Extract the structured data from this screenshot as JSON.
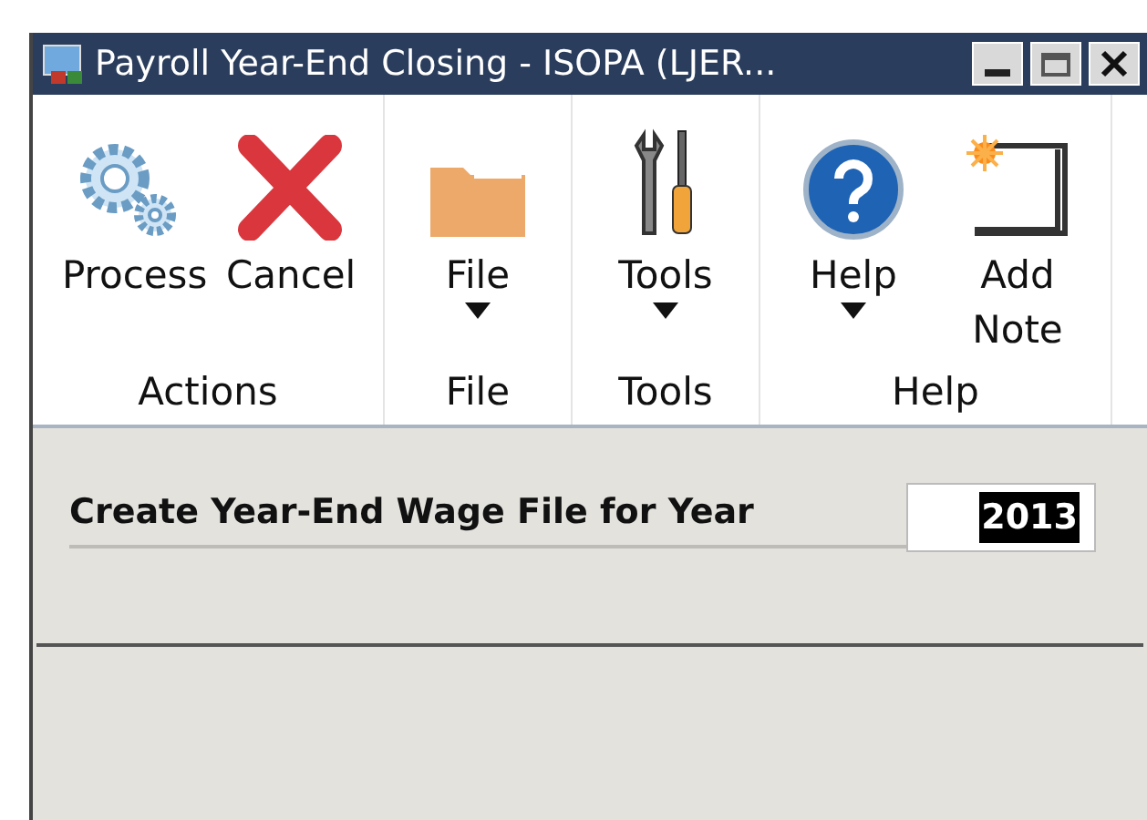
{
  "window": {
    "title": "Payroll Year-End Closing  -  ISOPA (LJER..."
  },
  "ribbon": {
    "groups": [
      {
        "label": "Actions",
        "buttons": [
          {
            "kind": "process",
            "label": "Process",
            "dropdown": false
          },
          {
            "kind": "cancel",
            "label": "Cancel",
            "dropdown": false
          }
        ]
      },
      {
        "label": "File",
        "buttons": [
          {
            "kind": "folder",
            "label": "File",
            "dropdown": true
          }
        ]
      },
      {
        "label": "Tools",
        "buttons": [
          {
            "kind": "tools",
            "label": "Tools",
            "dropdown": true
          }
        ]
      },
      {
        "label": "Help",
        "buttons": [
          {
            "kind": "help",
            "label": "Help",
            "dropdown": true
          },
          {
            "kind": "note",
            "label": "Add Note",
            "dropdown": false
          }
        ]
      }
    ]
  },
  "form": {
    "label": "Create Year-End Wage File for Year",
    "field": {
      "value": "2013",
      "selected": true
    }
  }
}
